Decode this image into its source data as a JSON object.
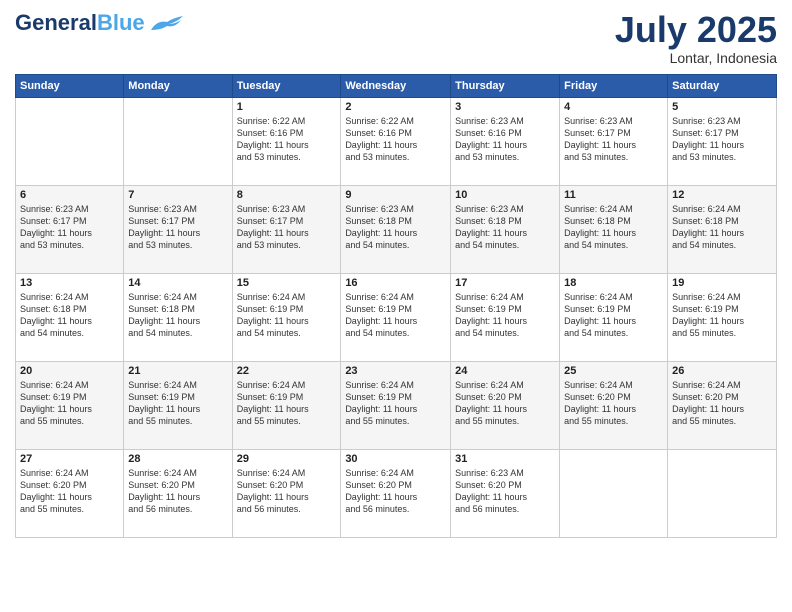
{
  "logo": {
    "text1": "General",
    "text2": "Blue"
  },
  "title": "July 2025",
  "location": "Lontar, Indonesia",
  "days_header": [
    "Sunday",
    "Monday",
    "Tuesday",
    "Wednesday",
    "Thursday",
    "Friday",
    "Saturday"
  ],
  "weeks": [
    [
      {
        "day": "",
        "detail": ""
      },
      {
        "day": "",
        "detail": ""
      },
      {
        "day": "1",
        "detail": "Sunrise: 6:22 AM\nSunset: 6:16 PM\nDaylight: 11 hours\nand 53 minutes."
      },
      {
        "day": "2",
        "detail": "Sunrise: 6:22 AM\nSunset: 6:16 PM\nDaylight: 11 hours\nand 53 minutes."
      },
      {
        "day": "3",
        "detail": "Sunrise: 6:23 AM\nSunset: 6:16 PM\nDaylight: 11 hours\nand 53 minutes."
      },
      {
        "day": "4",
        "detail": "Sunrise: 6:23 AM\nSunset: 6:17 PM\nDaylight: 11 hours\nand 53 minutes."
      },
      {
        "day": "5",
        "detail": "Sunrise: 6:23 AM\nSunset: 6:17 PM\nDaylight: 11 hours\nand 53 minutes."
      }
    ],
    [
      {
        "day": "6",
        "detail": "Sunrise: 6:23 AM\nSunset: 6:17 PM\nDaylight: 11 hours\nand 53 minutes."
      },
      {
        "day": "7",
        "detail": "Sunrise: 6:23 AM\nSunset: 6:17 PM\nDaylight: 11 hours\nand 53 minutes."
      },
      {
        "day": "8",
        "detail": "Sunrise: 6:23 AM\nSunset: 6:17 PM\nDaylight: 11 hours\nand 53 minutes."
      },
      {
        "day": "9",
        "detail": "Sunrise: 6:23 AM\nSunset: 6:18 PM\nDaylight: 11 hours\nand 54 minutes."
      },
      {
        "day": "10",
        "detail": "Sunrise: 6:23 AM\nSunset: 6:18 PM\nDaylight: 11 hours\nand 54 minutes."
      },
      {
        "day": "11",
        "detail": "Sunrise: 6:24 AM\nSunset: 6:18 PM\nDaylight: 11 hours\nand 54 minutes."
      },
      {
        "day": "12",
        "detail": "Sunrise: 6:24 AM\nSunset: 6:18 PM\nDaylight: 11 hours\nand 54 minutes."
      }
    ],
    [
      {
        "day": "13",
        "detail": "Sunrise: 6:24 AM\nSunset: 6:18 PM\nDaylight: 11 hours\nand 54 minutes."
      },
      {
        "day": "14",
        "detail": "Sunrise: 6:24 AM\nSunset: 6:18 PM\nDaylight: 11 hours\nand 54 minutes."
      },
      {
        "day": "15",
        "detail": "Sunrise: 6:24 AM\nSunset: 6:19 PM\nDaylight: 11 hours\nand 54 minutes."
      },
      {
        "day": "16",
        "detail": "Sunrise: 6:24 AM\nSunset: 6:19 PM\nDaylight: 11 hours\nand 54 minutes."
      },
      {
        "day": "17",
        "detail": "Sunrise: 6:24 AM\nSunset: 6:19 PM\nDaylight: 11 hours\nand 54 minutes."
      },
      {
        "day": "18",
        "detail": "Sunrise: 6:24 AM\nSunset: 6:19 PM\nDaylight: 11 hours\nand 54 minutes."
      },
      {
        "day": "19",
        "detail": "Sunrise: 6:24 AM\nSunset: 6:19 PM\nDaylight: 11 hours\nand 55 minutes."
      }
    ],
    [
      {
        "day": "20",
        "detail": "Sunrise: 6:24 AM\nSunset: 6:19 PM\nDaylight: 11 hours\nand 55 minutes."
      },
      {
        "day": "21",
        "detail": "Sunrise: 6:24 AM\nSunset: 6:19 PM\nDaylight: 11 hours\nand 55 minutes."
      },
      {
        "day": "22",
        "detail": "Sunrise: 6:24 AM\nSunset: 6:19 PM\nDaylight: 11 hours\nand 55 minutes."
      },
      {
        "day": "23",
        "detail": "Sunrise: 6:24 AM\nSunset: 6:19 PM\nDaylight: 11 hours\nand 55 minutes."
      },
      {
        "day": "24",
        "detail": "Sunrise: 6:24 AM\nSunset: 6:20 PM\nDaylight: 11 hours\nand 55 minutes."
      },
      {
        "day": "25",
        "detail": "Sunrise: 6:24 AM\nSunset: 6:20 PM\nDaylight: 11 hours\nand 55 minutes."
      },
      {
        "day": "26",
        "detail": "Sunrise: 6:24 AM\nSunset: 6:20 PM\nDaylight: 11 hours\nand 55 minutes."
      }
    ],
    [
      {
        "day": "27",
        "detail": "Sunrise: 6:24 AM\nSunset: 6:20 PM\nDaylight: 11 hours\nand 55 minutes."
      },
      {
        "day": "28",
        "detail": "Sunrise: 6:24 AM\nSunset: 6:20 PM\nDaylight: 11 hours\nand 56 minutes."
      },
      {
        "day": "29",
        "detail": "Sunrise: 6:24 AM\nSunset: 6:20 PM\nDaylight: 11 hours\nand 56 minutes."
      },
      {
        "day": "30",
        "detail": "Sunrise: 6:24 AM\nSunset: 6:20 PM\nDaylight: 11 hours\nand 56 minutes."
      },
      {
        "day": "31",
        "detail": "Sunrise: 6:23 AM\nSunset: 6:20 PM\nDaylight: 11 hours\nand 56 minutes."
      },
      {
        "day": "",
        "detail": ""
      },
      {
        "day": "",
        "detail": ""
      }
    ]
  ]
}
